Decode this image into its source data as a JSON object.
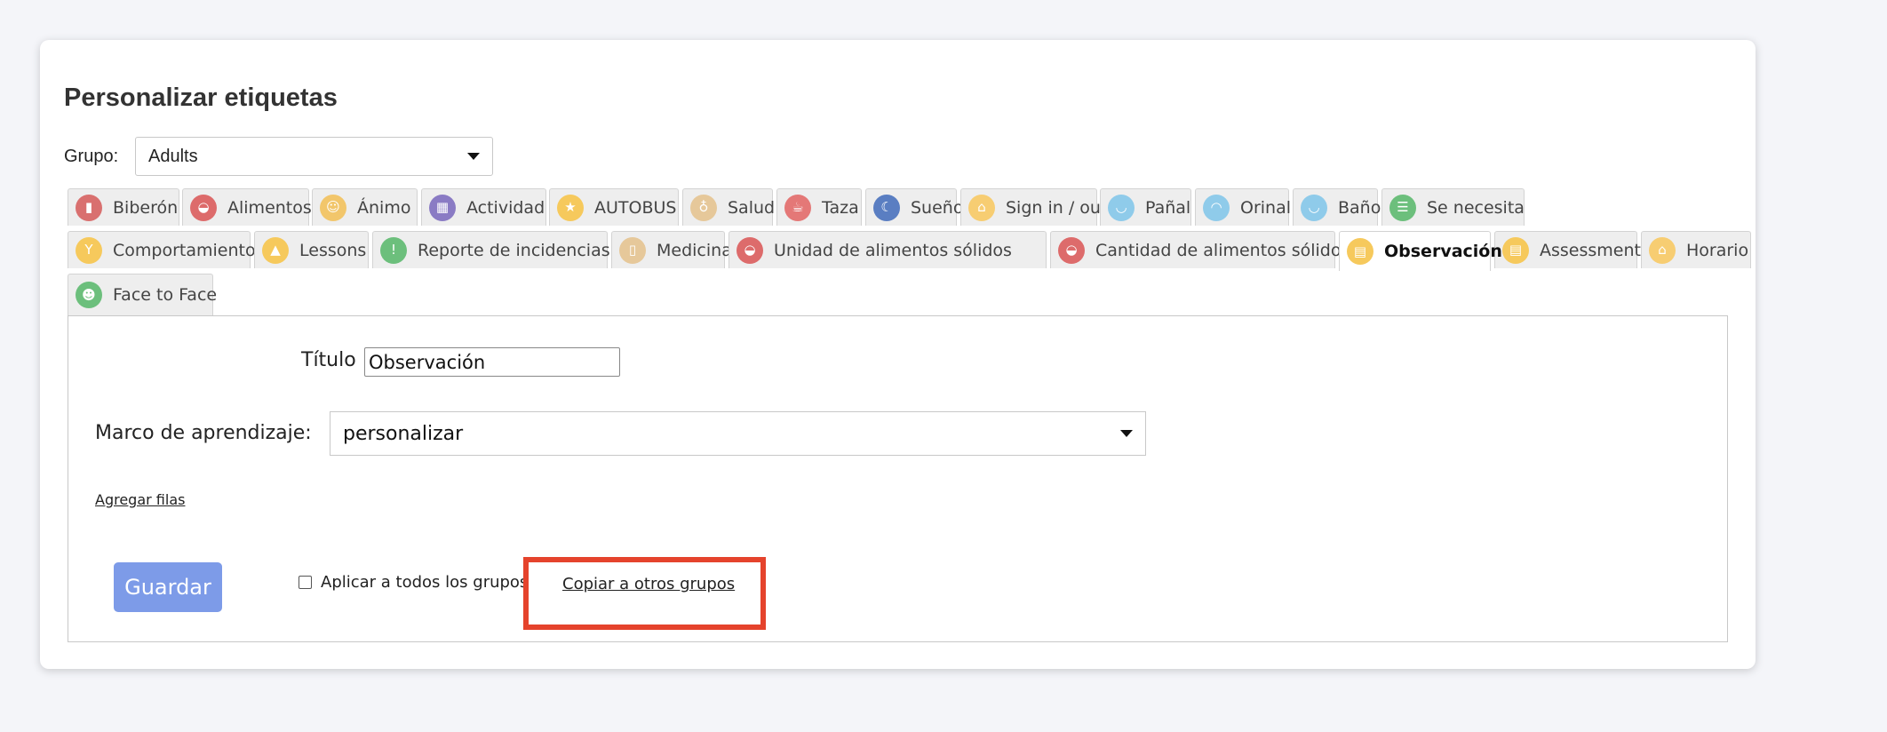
{
  "header": {
    "title": "Personalizar etiquetas"
  },
  "group": {
    "label": "Grupo:",
    "selected": "Adults"
  },
  "tabs": [
    {
      "label": "Biberón",
      "icon": "bottle-icon",
      "color": "#d9706f"
    },
    {
      "label": "Alimentos",
      "icon": "food-bowl-icon",
      "color": "#dd6b6b"
    },
    {
      "label": "Ánimo",
      "icon": "mood-icon",
      "color": "#f2c66b"
    },
    {
      "label": "Actividad",
      "icon": "activity-blocks-icon",
      "color": "#8a7bc4"
    },
    {
      "label": "AUTOBUS",
      "icon": "star-icon",
      "color": "#f6c95c"
    },
    {
      "label": "Salud",
      "icon": "stethoscope-icon",
      "color": "#e6c89a"
    },
    {
      "label": "Taza",
      "icon": "cup-icon",
      "color": "#e47877"
    },
    {
      "label": "Sueño",
      "icon": "moon-icon",
      "color": "#5a7ec2"
    },
    {
      "label": "Sign in / out",
      "icon": "home-icon",
      "color": "#f7cd72"
    },
    {
      "label": "Pañal",
      "icon": "diaper-icon",
      "color": "#8fcbea"
    },
    {
      "label": "Orinal",
      "icon": "potty-icon",
      "color": "#8fcbea"
    },
    {
      "label": "Baño",
      "icon": "bath-icon",
      "color": "#8fcbea"
    },
    {
      "label": "Se necesita",
      "icon": "checklist-icon",
      "color": "#6cbf7c"
    },
    {
      "label": "Comportamiento",
      "icon": "behavior-icon",
      "color": "#f6c95c"
    },
    {
      "label": "Lessons",
      "icon": "graduation-cap-icon",
      "color": "#f6c95c"
    },
    {
      "label": "Reporte de incidencias",
      "icon": "warning-icon",
      "color": "#6cbf7c"
    },
    {
      "label": "Medicina",
      "icon": "medicine-icon",
      "color": "#e6c89a"
    },
    {
      "label": "Unidad de alimentos sólidos",
      "icon": "food-bowl-icon",
      "color": "#dd6b6b"
    },
    {
      "label": "Cantidad de alimentos sólidos",
      "icon": "food-bowl-icon",
      "color": "#dd6b6b"
    },
    {
      "label": "Observación",
      "icon": "notepad-icon",
      "color": "#f6c95c",
      "active": true
    },
    {
      "label": "Assessment",
      "icon": "notepad-icon",
      "color": "#f6c95c"
    },
    {
      "label": "Horario",
      "icon": "home-icon",
      "color": "#f7cd72"
    },
    {
      "label": "Face to Face",
      "icon": "face-to-face-icon",
      "color": "#6cbf7c"
    }
  ],
  "form": {
    "title_label": "Título",
    "title_value": "Observación",
    "framework_label": "Marco de aprendizaje:",
    "framework_selected": "personalizar",
    "add_rows": "Agregar filas",
    "save": "Guardar",
    "apply_all": "Aplicar a todos los grupos",
    "copy_groups": "Copiar a otros grupos"
  },
  "colors": {
    "accent": "#7d9be8",
    "highlight": "#e5432c"
  }
}
